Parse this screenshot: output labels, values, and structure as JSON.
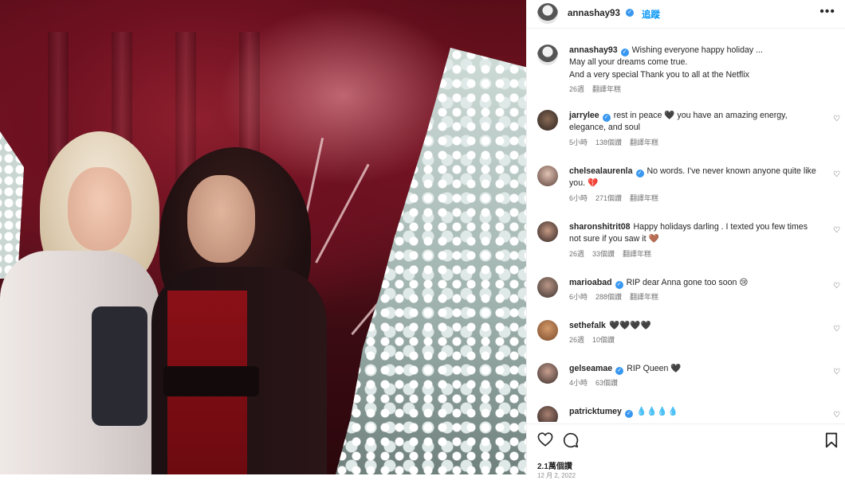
{
  "post": {
    "username": "annashay93",
    "follow_label": "追蹤",
    "more_label": "•••",
    "caption_lines": [
      "Wishing everyone happy holiday ...",
      "May all your dreams come true.",
      "And a very special Thank you to all at the Netflix"
    ],
    "caption_time": "26週",
    "caption_translate": "翻譯年糕"
  },
  "comments": [
    {
      "user": "jarrylee",
      "verified": true,
      "text": "rest in peace 🖤 you have an amazing energy, elegance, and soul",
      "time": "5小時",
      "likes": "138個讚",
      "translate": "翻譯年糕"
    },
    {
      "user": "chelsealaurenla",
      "verified": true,
      "text": "No words. I've never known anyone quite like you. 💔",
      "time": "6小時",
      "likes": "271個讚",
      "translate": "翻譯年糕"
    },
    {
      "user": "sharonshitrit08",
      "verified": false,
      "text": "Happy holidays darling . I texted you few times not sure if you saw it 🤎",
      "time": "26週",
      "likes": "33個讚",
      "translate": "翻譯年糕"
    },
    {
      "user": "marioabad",
      "verified": true,
      "text": "RIP dear Anna gone too soon 😢",
      "time": "6小時",
      "likes": "288個讚",
      "translate": "翻譯年糕"
    },
    {
      "user": "sethefalk",
      "verified": false,
      "text": "🖤🖤🖤🖤",
      "time": "26週",
      "likes": "10個讚",
      "translate": ""
    },
    {
      "user": "gelseamae",
      "verified": true,
      "text": "RIP Queen 🖤",
      "time": "4小時",
      "likes": "63個讚",
      "translate": ""
    },
    {
      "user": "patricktumey",
      "verified": true,
      "text": "💧💧💧💧",
      "time": "",
      "likes": "",
      "translate": ""
    }
  ],
  "footer": {
    "likes": "2.1萬個讚",
    "date": "12 月 2, 2022"
  },
  "icons": {
    "heart": "heart-icon",
    "comment": "comment-icon",
    "bookmark": "bookmark-icon",
    "verified": "verified-badge-icon"
  },
  "colors": {
    "accent": "#0095f6",
    "verified": "#3897f0"
  }
}
